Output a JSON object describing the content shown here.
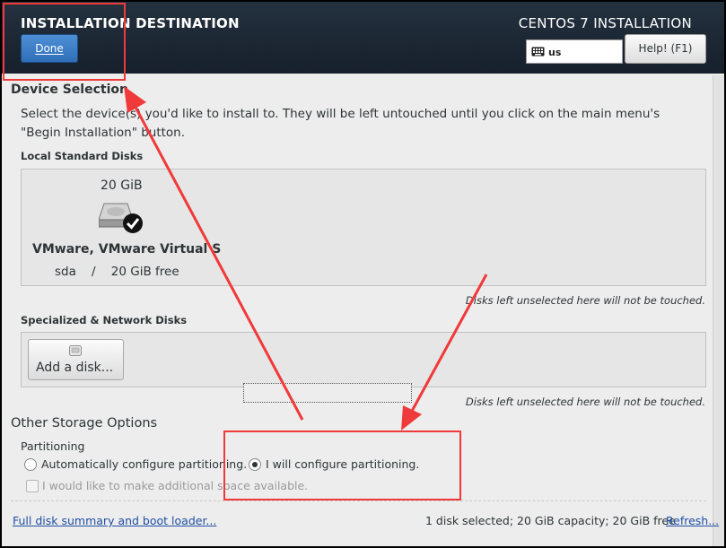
{
  "header": {
    "title": "INSTALLATION DESTINATION",
    "product": "CENTOS 7 INSTALLATION",
    "done_label": "Done",
    "keyboard_layout": "us",
    "help_label": "Help! (F1)"
  },
  "device_selection": {
    "title": "Device Selection",
    "description_line1": "Select the device(s) you'd like to install to.  They will be left untouched until you click on the main menu's",
    "description_line2": "\"Begin Installation\" button.",
    "local_disks_title": "Local Standard Disks",
    "disks": [
      {
        "size": "20 GiB",
        "name": "VMware, VMware Virtual S",
        "device": "sda",
        "free": "20 GiB free",
        "selected": true
      }
    ],
    "local_note": "Disks left unselected here will not be touched.",
    "specialized_title": "Specialized & Network Disks",
    "add_disk_label": "Add a disk...",
    "specialized_note": "Disks left unselected here will not be touched."
  },
  "other_storage": {
    "title": "Other Storage Options",
    "partitioning_title": "Partitioning",
    "auto_option": "Automatically configure partitioning.",
    "manual_option": "I will configure partitioning.",
    "selected_option": "manual",
    "extra_space_label": "I would like to make additional space available.",
    "extra_space_enabled": false
  },
  "footer": {
    "summary_link": "Full disk summary and boot loader...",
    "status": "1 disk selected; 20 GiB capacity; 20 GiB free",
    "refresh_link": "Refresh..."
  },
  "colors": {
    "header_bg": "#1c2734",
    "done_button": "#3a7bc8",
    "annotation_red": "#f0393a",
    "link": "#1f4fa3"
  }
}
